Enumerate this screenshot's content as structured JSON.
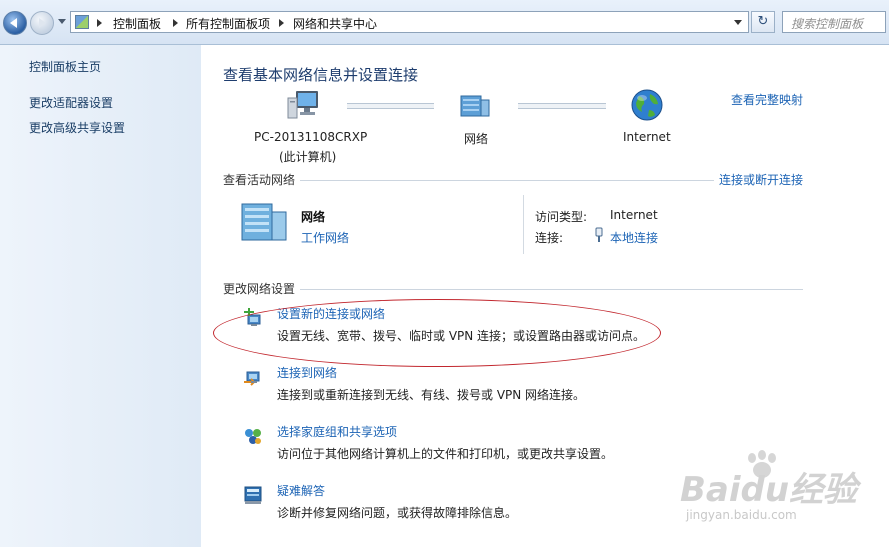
{
  "address": {
    "breadcrumbs": [
      "控制面板",
      "所有控制面板项",
      "网络和共享中心"
    ],
    "search_placeholder": "搜索控制面板",
    "refresh_glyph": "↻"
  },
  "sidebar": {
    "items": [
      {
        "label": "控制面板主页"
      },
      {
        "label": "更改适配器设置"
      },
      {
        "label": "更改高级共享设置"
      }
    ]
  },
  "main": {
    "title": "查看基本网络信息并设置连接",
    "full_map_link": "查看完整映射",
    "map": {
      "computer_name": "PC-20131108CRXP",
      "computer_sub": "(此计算机)",
      "network": "网络",
      "internet": "Internet"
    },
    "active": {
      "heading": "查看活动网络",
      "connect_link": "连接或断开连接",
      "network_name": "网络",
      "network_type": "工作网络",
      "access_label": "访问类型:",
      "access_value": "Internet",
      "conn_label": "连接:",
      "conn_value": "本地连接"
    },
    "change": {
      "heading": "更改网络设置",
      "tasks": [
        {
          "title": "设置新的连接或网络",
          "desc": "设置无线、宽带、拨号、临时或 VPN 连接；或设置路由器或访问点。",
          "icon": "new-connection-icon"
        },
        {
          "title": "连接到网络",
          "desc": "连接到或重新连接到无线、有线、拨号或 VPN 网络连接。",
          "icon": "connect-network-icon"
        },
        {
          "title": "选择家庭组和共享选项",
          "desc": "访问位于其他网络计算机上的文件和打印机，或更改共享设置。",
          "icon": "homegroup-icon"
        },
        {
          "title": "疑难解答",
          "desc": "诊断并修复网络问题，或获得故障排除信息。",
          "icon": "troubleshoot-icon"
        }
      ]
    }
  },
  "watermark": {
    "brand": "Baidu经验",
    "url": "jingyan.baidu.com"
  },
  "colors": {
    "link": "#1d64b5",
    "title": "#1e3d6e",
    "annotation": "#c2282f"
  }
}
